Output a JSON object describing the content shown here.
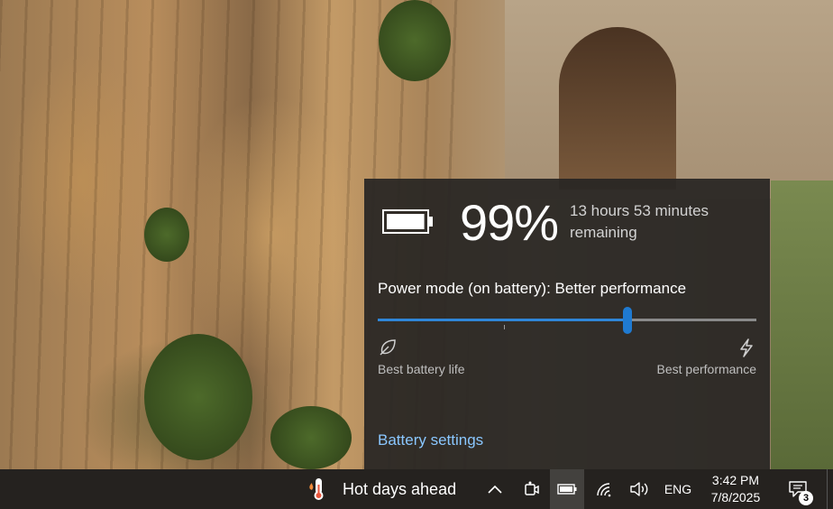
{
  "flyout": {
    "battery_percent": "99%",
    "battery_level": 0.99,
    "time_remaining": "13 hours 53 minutes remaining",
    "power_mode_label": "Power mode (on battery): Better performance",
    "slider": {
      "value": 0.66,
      "left_caption": "Best battery life",
      "right_caption": "Best performance",
      "track_color": "#8a8a8a",
      "fill_color": "#2f86d8"
    },
    "settings_link": "Battery settings",
    "icons": {
      "battery": "battery-icon",
      "leaf": "leaf-icon",
      "bolt": "lightning-bolt-icon"
    }
  },
  "taskbar": {
    "weather_text": "Hot days ahead",
    "weather_icon": "thermometer-icon",
    "tray_icons": [
      "chevron-up-icon",
      "meet-now-icon",
      "battery-icon",
      "wifi-icon",
      "volume-icon"
    ],
    "language": "ENG",
    "time": "3:42 PM",
    "date": "7/8/2025",
    "notification_count": "3",
    "accent_color": "#1f7ad1"
  }
}
